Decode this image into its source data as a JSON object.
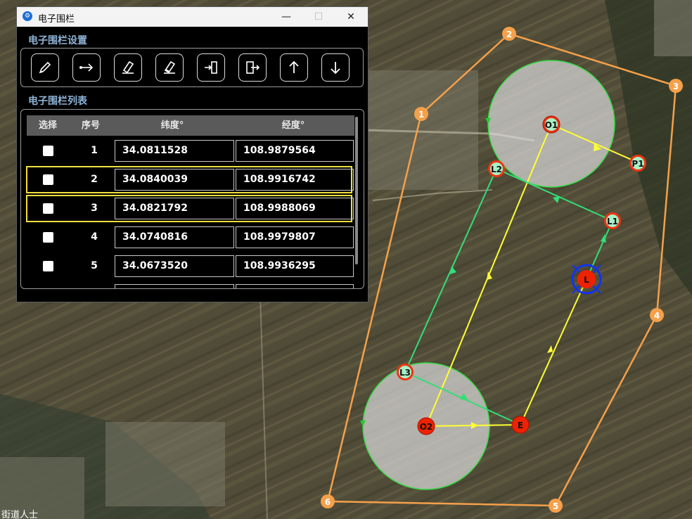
{
  "window": {
    "title": "电子围栏",
    "minimize": "—",
    "maximize": "☐",
    "close": "✕"
  },
  "settings": {
    "title": "电子围栏设置",
    "tools": [
      {
        "name": "pen-icon"
      },
      {
        "name": "arrow-right-icon"
      },
      {
        "name": "eraser-icon"
      },
      {
        "name": "eraser-clear-icon"
      },
      {
        "name": "import-icon"
      },
      {
        "name": "export-icon"
      },
      {
        "name": "arrow-up-icon"
      },
      {
        "name": "arrow-down-icon"
      }
    ]
  },
  "list": {
    "title": "电子围栏列表",
    "headers": {
      "select": "选择",
      "index": "序号",
      "lat": "纬度°",
      "lon": "经度°"
    },
    "rows": [
      {
        "index": "1",
        "lat": "34.0811528",
        "lon": "108.9879564",
        "selected": false
      },
      {
        "index": "2",
        "lat": "34.0840039",
        "lon": "108.9916742",
        "selected": true
      },
      {
        "index": "3",
        "lat": "34.0821792",
        "lon": "108.9988069",
        "selected": true
      },
      {
        "index": "4",
        "lat": "34.0740816",
        "lon": "108.9979807",
        "selected": false
      },
      {
        "index": "5",
        "lat": "34.0673520",
        "lon": "108.9936295",
        "selected": false
      }
    ]
  },
  "map": {
    "fence_vertices": [
      "1",
      "2",
      "3",
      "4",
      "5",
      "6"
    ],
    "markers": {
      "o1": "O1",
      "o2": "O2",
      "p1": "P1",
      "l1": "L1",
      "l2": "L2",
      "l3": "L3",
      "e": "E",
      "l": "L"
    },
    "corner_text": "街道人士",
    "colors": {
      "fence": "#f5a04a",
      "circle": "#d8d8d8",
      "yellow_path": "#ffff33",
      "green_path": "#33dd77",
      "marker_red": "#ee2200",
      "marker_green": "#a8f0c8"
    }
  }
}
